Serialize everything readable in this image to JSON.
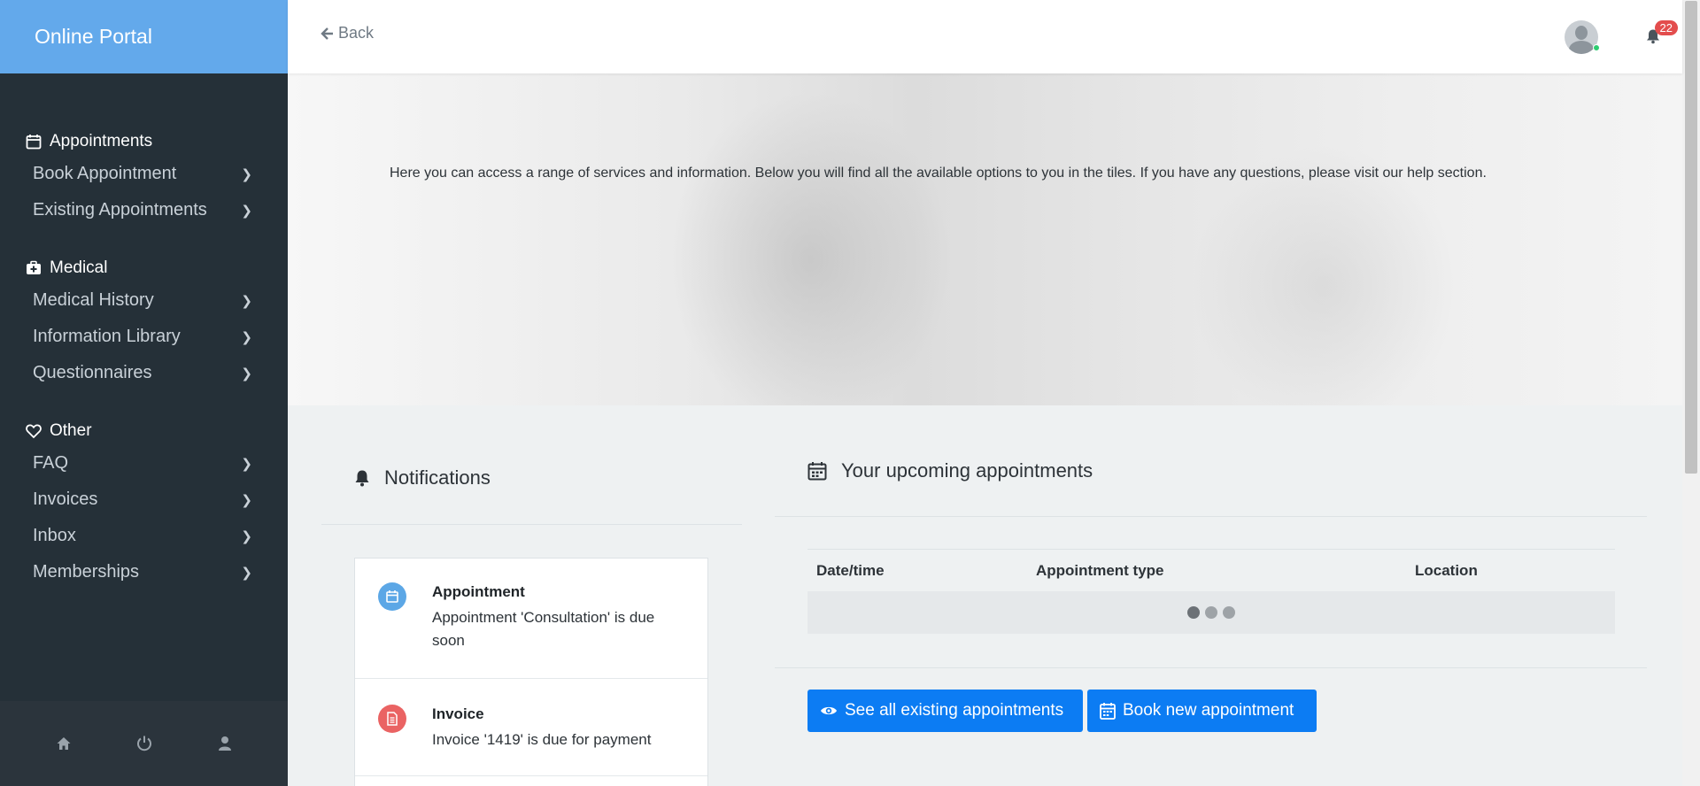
{
  "app": {
    "title": "Online Portal"
  },
  "sidebar": {
    "sections": [
      {
        "heading": "Appointments",
        "icon": "calendar-icon",
        "items": [
          {
            "label": "Book Appointment"
          },
          {
            "label": "Existing Appointments"
          }
        ]
      },
      {
        "heading": "Medical",
        "icon": "medical-kit-icon",
        "items": [
          {
            "label": "Medical History"
          },
          {
            "label": "Information Library"
          },
          {
            "label": "Questionnaires"
          }
        ]
      },
      {
        "heading": "Other",
        "icon": "heart-icon",
        "items": [
          {
            "label": "FAQ"
          },
          {
            "label": "Invoices"
          },
          {
            "label": "Inbox"
          },
          {
            "label": "Memberships"
          }
        ]
      }
    ],
    "footer_icons": [
      "home-icon",
      "power-icon",
      "user-icon"
    ]
  },
  "topbar": {
    "back_label": "Back",
    "notification_count": "22"
  },
  "hero": {
    "text": "Here you can access a range of services and information. Below you will find all the available options to you in the tiles. If you have any questions, please visit our help section."
  },
  "notifications": {
    "title": "Notifications",
    "items": [
      {
        "title": "Appointment",
        "text": "Appointment 'Consultation' is due soon",
        "icon": "calendar-icon",
        "color": "#5ca7e6"
      },
      {
        "title": "Invoice",
        "text": "Invoice '1419' is due for payment",
        "icon": "document-icon",
        "color": "#ea6363"
      }
    ]
  },
  "appointments": {
    "title": "Your upcoming appointments",
    "columns": [
      "Date/time",
      "Appointment type",
      "Location"
    ],
    "see_all_label": "See all existing appointments",
    "book_new_label": "Book new appointment"
  },
  "colors": {
    "brand": "#63a9eb",
    "sidebar": "#253038",
    "primary_button": "#0c7cf3",
    "badge": "#e34d4d"
  }
}
